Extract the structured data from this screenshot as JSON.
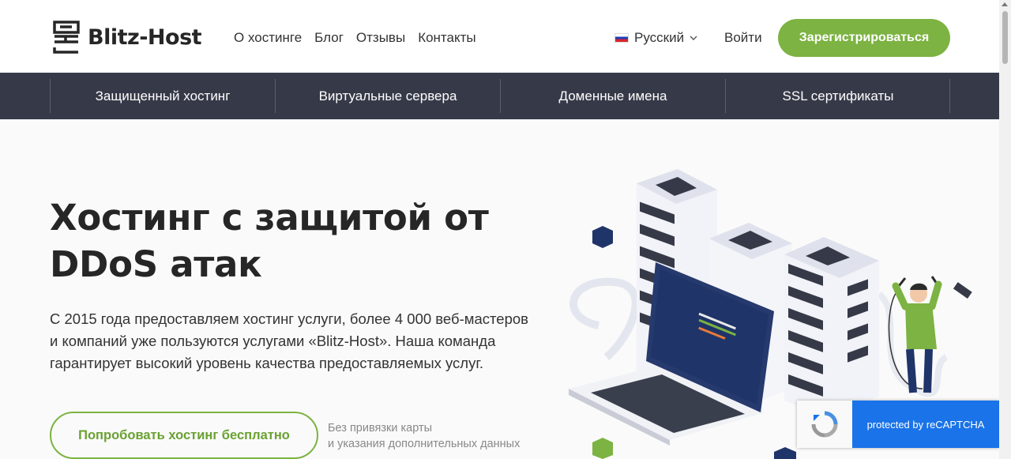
{
  "header": {
    "logo_text": "Blitz-Host",
    "nav": [
      "О хостинге",
      "Блог",
      "Отзывы",
      "Контакты"
    ],
    "language": "Русский",
    "login": "Войти",
    "register": "Зарегистрироваться"
  },
  "services_nav": [
    "Защищенный хостинг",
    "Виртуальные сервера",
    "Доменные имена",
    "SSL сертификаты"
  ],
  "hero": {
    "title": "Хостинг с защитой от DDoS атак",
    "text": "С 2015 года предоставляем хостинг услуги, более 4 000 веб-мастеров и компаний уже пользуются услугами «Blitz-Host». Наша команда гарантирует высокий уровень качества предоставляемых услуг.",
    "try_button": "Попробовать хостинг бесплатно",
    "note_line1": "Без привязки карты",
    "note_line2": "и указания дополнительных данных"
  },
  "recaptcha": {
    "label": "protected by reCAPTCHA"
  },
  "colors": {
    "accent": "#7cb342",
    "nav_bg": "#363a48",
    "recaptcha_blue": "#1a73e8"
  },
  "icons": [
    "logo-mark-icon",
    "russia-flag-icon",
    "chevron-down-icon",
    "recaptcha-icon"
  ]
}
